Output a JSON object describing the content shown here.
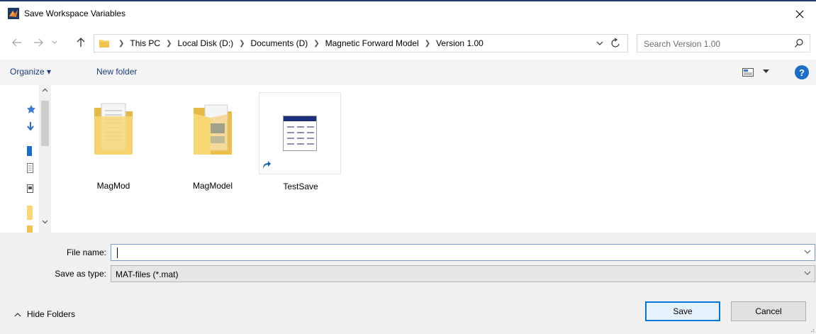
{
  "window": {
    "title": "Save Workspace Variables",
    "app_icon": "matlab-icon",
    "accent_color": "#0078d7"
  },
  "address": {
    "breadcrumbs": [
      "This PC",
      "Local Disk (D:)",
      "Documents (D)",
      "Magnetic Forward Model",
      "Version 1.00"
    ]
  },
  "search": {
    "placeholder": "Search Version 1.00"
  },
  "toolbar": {
    "organize_label": "Organize ▾",
    "new_folder_label": "New folder",
    "help_label": "?"
  },
  "files": [
    {
      "name": "MagMod",
      "icon": "folder-icon"
    },
    {
      "name": "MagModel",
      "icon": "folder-icon"
    },
    {
      "name": "TestSave",
      "icon": "mat-file-shortcut-icon"
    }
  ],
  "form": {
    "file_name_label": "File name:",
    "file_name_value": "",
    "save_type_label": "Save as type:",
    "save_type_value": "MAT-files (*.mat)"
  },
  "footer": {
    "hide_folders_label": "Hide Folders",
    "save_label": "Save",
    "cancel_label": "Cancel"
  }
}
